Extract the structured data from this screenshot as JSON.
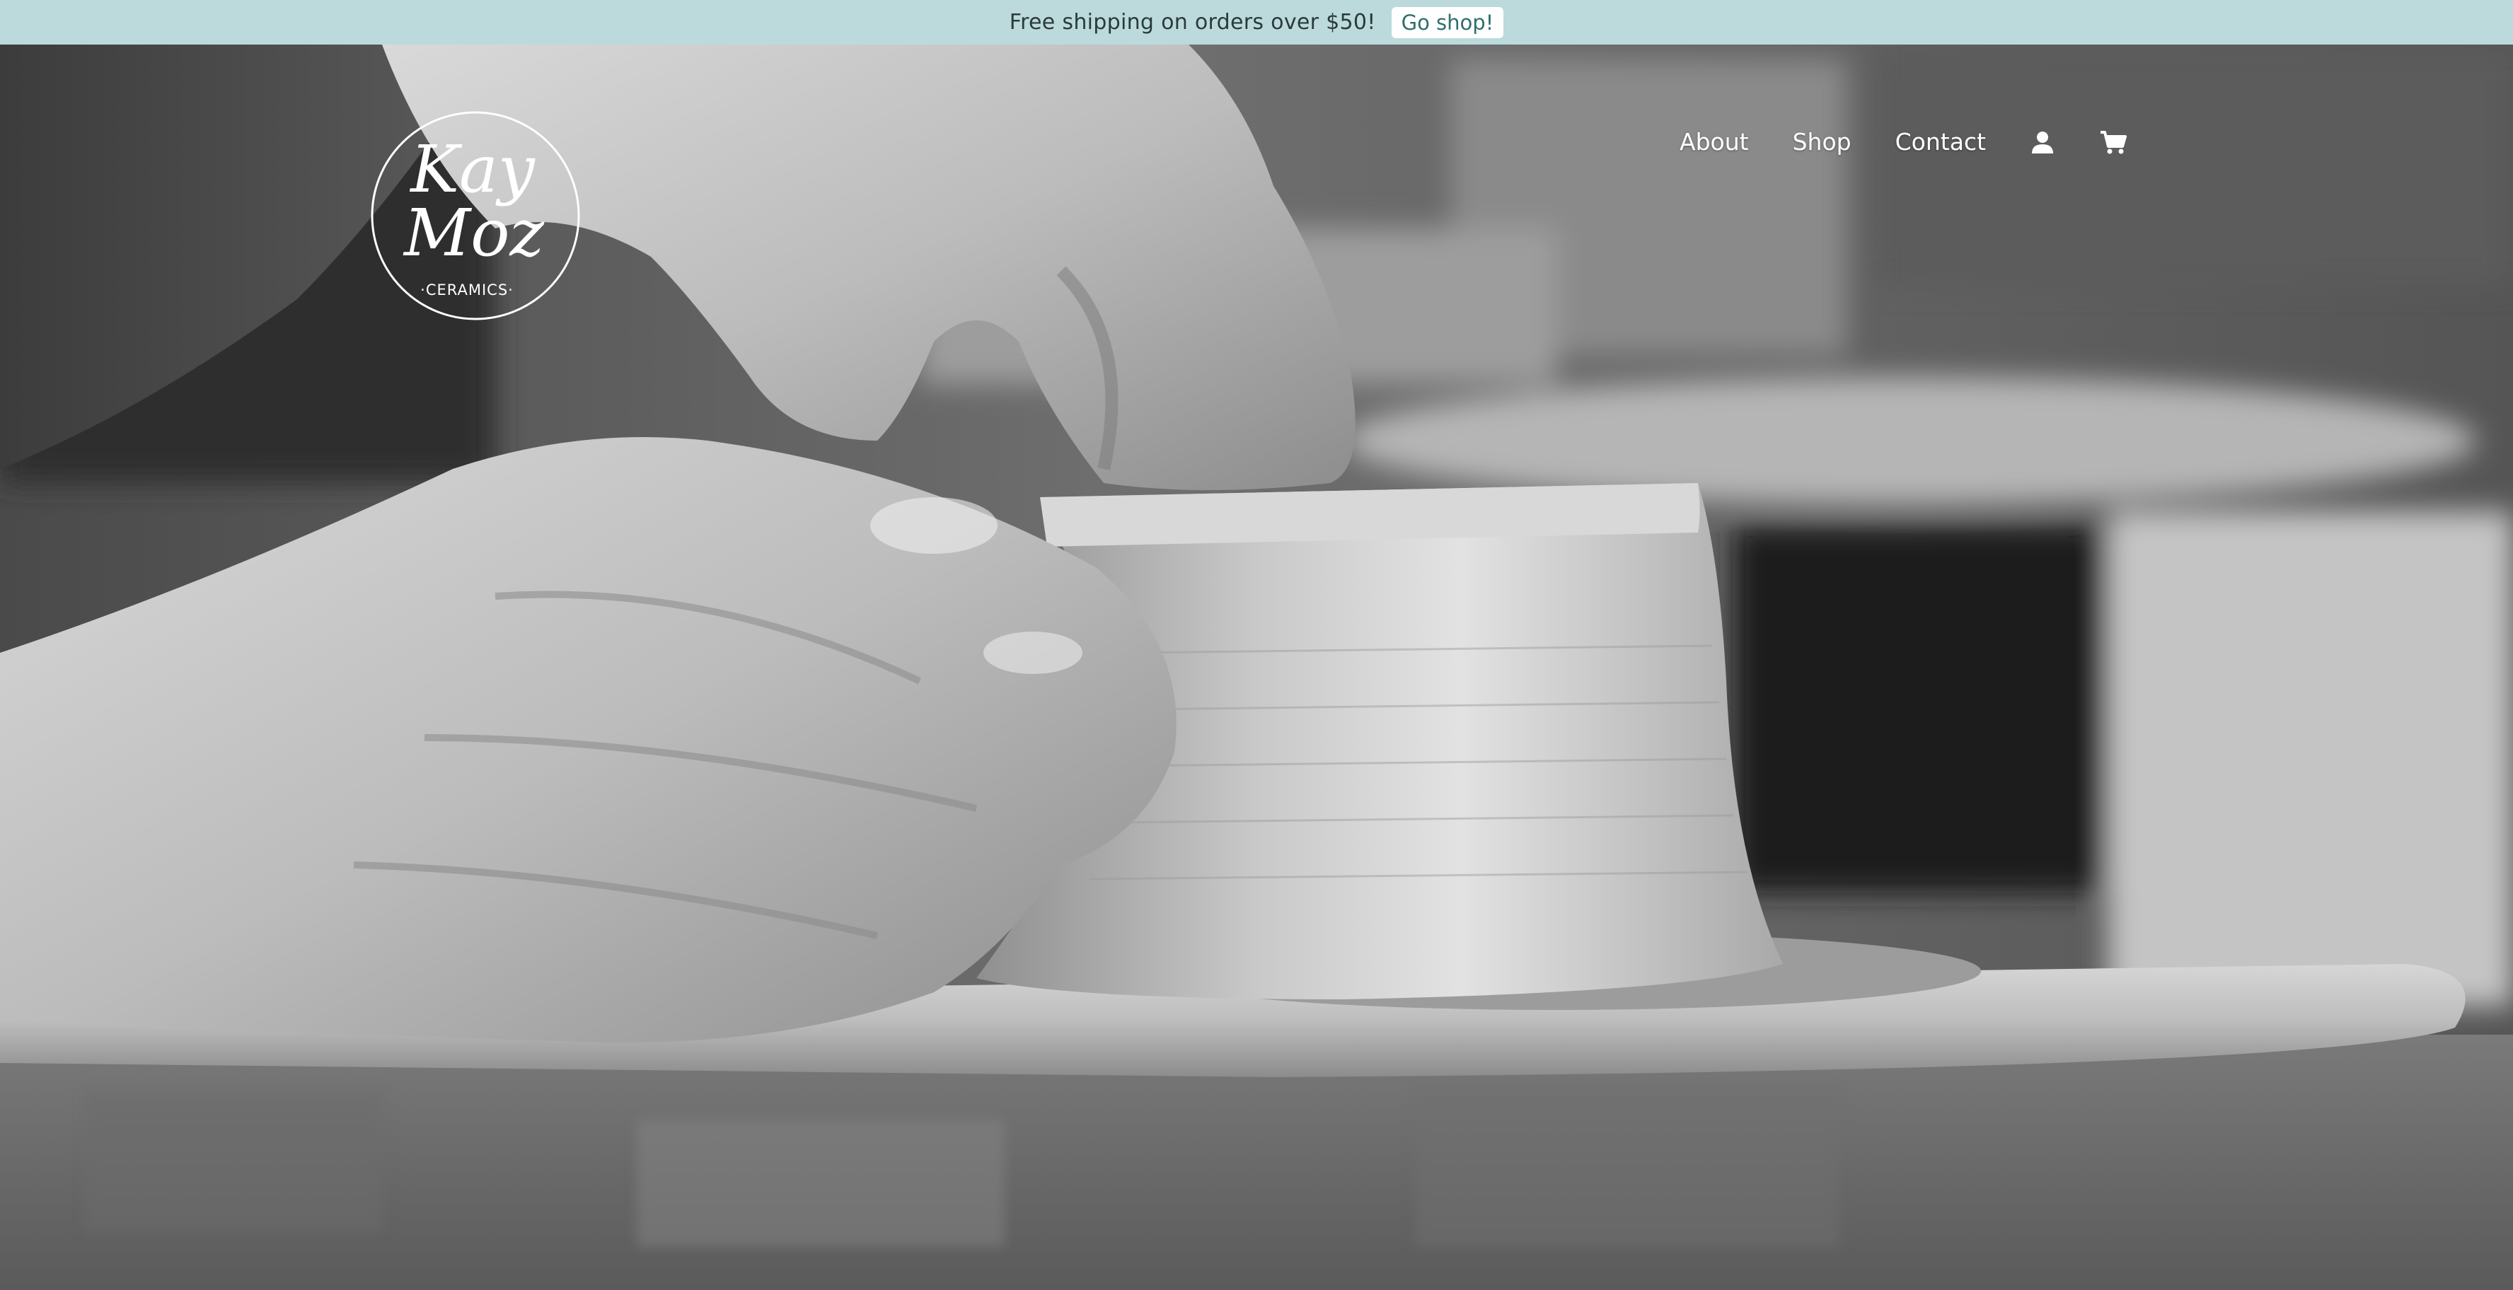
{
  "announcement": {
    "text": "Free shipping on orders over $50!",
    "cta_label": "Go shop!",
    "background": "#bcdadb"
  },
  "brand": {
    "logo_name": "Kay Moz Ceramics logo",
    "logo_line1": "Kay",
    "logo_line2": "Moz",
    "logo_tagline": "·CERAMICS·"
  },
  "nav": {
    "items": [
      {
        "label": "About"
      },
      {
        "label": "Shop"
      },
      {
        "label": "Contact"
      }
    ],
    "account_icon": "user-icon",
    "cart_icon": "cart-icon"
  },
  "hero": {
    "image": "black-and-white photo of hands shaping clay on a pottery wheel"
  }
}
